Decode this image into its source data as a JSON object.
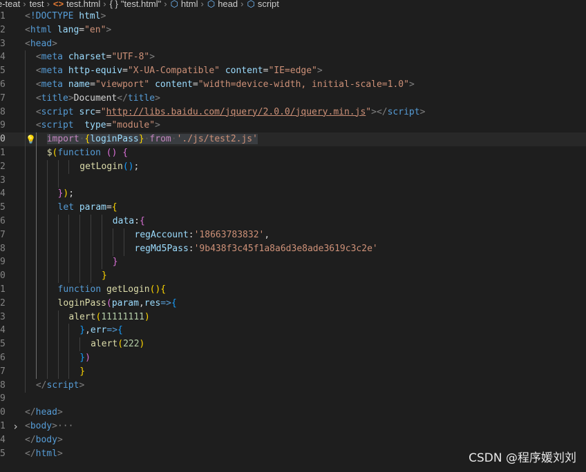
{
  "breadcrumb": {
    "items": [
      {
        "label": "e-teat",
        "icon": ""
      },
      {
        "label": "test",
        "icon": ""
      },
      {
        "label": "test.html",
        "icon": "html-file-icon"
      },
      {
        "label": "\"test.html\"",
        "icon": "braces-icon"
      },
      {
        "label": "html",
        "icon": "cube-icon"
      },
      {
        "label": "head",
        "icon": "cube-icon"
      },
      {
        "label": "script",
        "icon": "cube-icon"
      }
    ]
  },
  "editor": {
    "current_line": 10,
    "lines": [
      {
        "n": "1",
        "indent": 0,
        "tokens": [
          [
            "br",
            "<"
          ],
          [
            "tag",
            "!DOCTYPE"
          ],
          [
            "txt",
            " "
          ],
          [
            "attr",
            "html"
          ],
          [
            "br",
            ">"
          ]
        ]
      },
      {
        "n": "2",
        "indent": 0,
        "tokens": [
          [
            "br",
            "<"
          ],
          [
            "tag",
            "html"
          ],
          [
            "txt",
            " "
          ],
          [
            "attr",
            "lang"
          ],
          [
            "txt",
            "="
          ],
          [
            "str",
            "\"en\""
          ],
          [
            "br",
            ">"
          ]
        ]
      },
      {
        "n": "3",
        "indent": 0,
        "tokens": [
          [
            "br",
            "<"
          ],
          [
            "tag",
            "head"
          ],
          [
            "br",
            ">"
          ]
        ]
      },
      {
        "n": "4",
        "indent": 1,
        "tokens": [
          [
            "br",
            "<"
          ],
          [
            "tag",
            "meta"
          ],
          [
            "txt",
            " "
          ],
          [
            "attr",
            "charset"
          ],
          [
            "txt",
            "="
          ],
          [
            "str",
            "\"UTF-8\""
          ],
          [
            "br",
            ">"
          ]
        ]
      },
      {
        "n": "5",
        "indent": 1,
        "tokens": [
          [
            "br",
            "<"
          ],
          [
            "tag",
            "meta"
          ],
          [
            "txt",
            " "
          ],
          [
            "attr",
            "http-equiv"
          ],
          [
            "txt",
            "="
          ],
          [
            "str",
            "\"X-UA-Compatible\""
          ],
          [
            "txt",
            " "
          ],
          [
            "attr",
            "content"
          ],
          [
            "txt",
            "="
          ],
          [
            "str",
            "\"IE=edge\""
          ],
          [
            "br",
            ">"
          ]
        ]
      },
      {
        "n": "6",
        "indent": 1,
        "tokens": [
          [
            "br",
            "<"
          ],
          [
            "tag",
            "meta"
          ],
          [
            "txt",
            " "
          ],
          [
            "attr",
            "name"
          ],
          [
            "txt",
            "="
          ],
          [
            "str",
            "\"viewport\""
          ],
          [
            "txt",
            " "
          ],
          [
            "attr",
            "content"
          ],
          [
            "txt",
            "="
          ],
          [
            "str",
            "\"width=device-width, initial-scale=1.0\""
          ],
          [
            "br",
            ">"
          ]
        ]
      },
      {
        "n": "7",
        "indent": 1,
        "tokens": [
          [
            "br",
            "<"
          ],
          [
            "tag",
            "title"
          ],
          [
            "br",
            ">"
          ],
          [
            "txt",
            "Document"
          ],
          [
            "br",
            "</"
          ],
          [
            "tag",
            "title"
          ],
          [
            "br",
            ">"
          ]
        ]
      },
      {
        "n": "8",
        "indent": 1,
        "tokens": [
          [
            "br",
            "<"
          ],
          [
            "tag",
            "script"
          ],
          [
            "txt",
            " "
          ],
          [
            "attr",
            "src"
          ],
          [
            "txt",
            "="
          ],
          [
            "str",
            "\""
          ],
          [
            "str url",
            "http://libs.baidu.com/jquery/2.0.0/jquery.min.js"
          ],
          [
            "str",
            "\""
          ],
          [
            "br",
            "></"
          ],
          [
            "tag",
            "script"
          ],
          [
            "br",
            ">"
          ]
        ]
      },
      {
        "n": "9",
        "indent": 1,
        "tokens": [
          [
            "br",
            "<"
          ],
          [
            "tag",
            "script"
          ],
          [
            "txt",
            "  "
          ],
          [
            "attr",
            "type"
          ],
          [
            "txt",
            "="
          ],
          [
            "str",
            "\"module\""
          ],
          [
            "br",
            ">"
          ]
        ]
      },
      {
        "n": "0",
        "indent": 2,
        "tokens": [
          [
            "kw hl",
            "import"
          ],
          [
            "ws hl",
            "·"
          ],
          [
            "p1 hl",
            "{"
          ],
          [
            "attr hl",
            "loginPass"
          ],
          [
            "p1 hl",
            "}"
          ],
          [
            "ws hl",
            "·"
          ],
          [
            "kw hl",
            "from"
          ],
          [
            "ws hl",
            "·"
          ],
          [
            "str hl",
            "'./js/test2.js'"
          ]
        ]
      },
      {
        "n": "1",
        "indent": 2,
        "tokens": [
          [
            "fn",
            "$"
          ],
          [
            "p1",
            "("
          ],
          [
            "kwb",
            "function"
          ],
          [
            "txt",
            " "
          ],
          [
            "p2",
            "()"
          ],
          [
            "txt",
            " "
          ],
          [
            "p2",
            "{"
          ]
        ]
      },
      {
        "n": "2",
        "indent": 5,
        "tokens": [
          [
            "fn",
            "getLogin"
          ],
          [
            "p3",
            "()"
          ],
          [
            "txt",
            ";"
          ]
        ]
      },
      {
        "n": "3",
        "indent": 4,
        "tokens": []
      },
      {
        "n": "4",
        "indent": 3,
        "tokens": [
          [
            "p2",
            "}"
          ],
          [
            "p1",
            ")"
          ],
          [
            "txt",
            ";"
          ]
        ]
      },
      {
        "n": "5",
        "indent": 3,
        "tokens": [
          [
            "kwb",
            "let"
          ],
          [
            "txt",
            " "
          ],
          [
            "attr",
            "param"
          ],
          [
            "txt",
            "="
          ],
          [
            "p1",
            "{"
          ]
        ]
      },
      {
        "n": "6",
        "indent": 8,
        "tokens": [
          [
            "attr",
            "data"
          ],
          [
            "txt",
            ":"
          ],
          [
            "p2",
            "{"
          ]
        ]
      },
      {
        "n": "7",
        "indent": 10,
        "tokens": [
          [
            "attr",
            "regAccount"
          ],
          [
            "txt",
            ":"
          ],
          [
            "str",
            "'18663783832'"
          ],
          [
            "txt",
            ","
          ]
        ]
      },
      {
        "n": "8",
        "indent": 10,
        "tokens": [
          [
            "attr",
            "regMd5Pass"
          ],
          [
            "txt",
            ":"
          ],
          [
            "str",
            "'9b438f3c45f1a8a6d3e8ade3619c3c2e'"
          ]
        ]
      },
      {
        "n": "9",
        "indent": 8,
        "tokens": [
          [
            "p2",
            "}"
          ]
        ]
      },
      {
        "n": "0",
        "indent": 7,
        "tokens": [
          [
            "p1",
            "}"
          ]
        ]
      },
      {
        "n": "1",
        "indent": 3,
        "tokens": [
          [
            "kwb",
            "function"
          ],
          [
            "txt",
            " "
          ],
          [
            "fn",
            "getLogin"
          ],
          [
            "p1",
            "()"
          ],
          [
            "p1",
            "{"
          ]
        ]
      },
      {
        "n": "2",
        "indent": 3,
        "tokens": [
          [
            "fn",
            "loginPass"
          ],
          [
            "p2",
            "("
          ],
          [
            "attr",
            "param"
          ],
          [
            "txt",
            ","
          ],
          [
            "attr",
            "res"
          ],
          [
            "kwb",
            "=>"
          ],
          [
            "p3",
            "{"
          ]
        ]
      },
      {
        "n": "3",
        "indent": 4,
        "tokens": [
          [
            "fn",
            "alert"
          ],
          [
            "p1",
            "("
          ],
          [
            "num",
            "11111111"
          ],
          [
            "p1",
            ")"
          ]
        ]
      },
      {
        "n": "4",
        "indent": 5,
        "tokens": [
          [
            "p3",
            "}"
          ],
          [
            "txt",
            ","
          ],
          [
            "attr",
            "err"
          ],
          [
            "kwb",
            "=>"
          ],
          [
            "p3",
            "{"
          ]
        ]
      },
      {
        "n": "5",
        "indent": 6,
        "tokens": [
          [
            "fn",
            "alert"
          ],
          [
            "p1",
            "("
          ],
          [
            "num",
            "222"
          ],
          [
            "p1",
            ")"
          ]
        ]
      },
      {
        "n": "6",
        "indent": 5,
        "tokens": [
          [
            "p3",
            "}"
          ],
          [
            "p2",
            ")"
          ]
        ]
      },
      {
        "n": "7",
        "indent": 5,
        "tokens": [
          [
            "p1",
            "}"
          ]
        ]
      },
      {
        "n": "8",
        "indent": 1,
        "tokens": [
          [
            "br",
            "</"
          ],
          [
            "tag",
            "script"
          ],
          [
            "br",
            ">"
          ]
        ]
      },
      {
        "n": "9",
        "indent": 0,
        "tokens": []
      },
      {
        "n": "0",
        "indent": 0,
        "tokens": [
          [
            "br",
            "</"
          ],
          [
            "tag",
            "head"
          ],
          [
            "br",
            ">"
          ]
        ]
      },
      {
        "n": "1",
        "indent": 0,
        "tokens": [
          [
            "br",
            "<"
          ],
          [
            "tag",
            "body"
          ],
          [
            "br",
            ">"
          ],
          [
            "dots",
            "···"
          ]
        ]
      },
      {
        "n": "4",
        "indent": 0,
        "tokens": [
          [
            "br",
            "</"
          ],
          [
            "tag",
            "body"
          ],
          [
            "br",
            ">"
          ]
        ]
      },
      {
        "n": "5",
        "indent": 0,
        "tokens": [
          [
            "br",
            "</"
          ],
          [
            "tag",
            "html"
          ],
          [
            "br",
            ">"
          ]
        ]
      }
    ]
  },
  "watermark": "CSDN @程序媛刘刘"
}
